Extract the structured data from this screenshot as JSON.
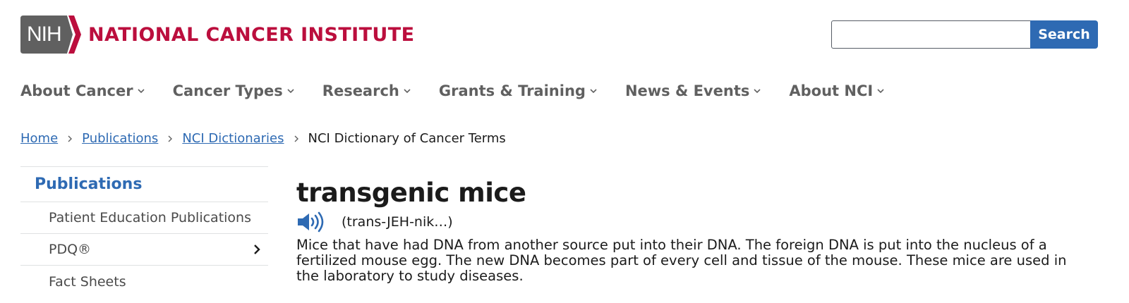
{
  "header": {
    "logo_mark": "NIH",
    "org_name": "NATIONAL CANCER INSTITUTE",
    "search_placeholder": "",
    "search_button": "Search",
    "brand_color": "#bb0e3d",
    "logo_gray": "#606060"
  },
  "nav": {
    "items": [
      {
        "label": "About Cancer",
        "icon": "chevron-down-icon"
      },
      {
        "label": "Cancer Types",
        "icon": "chevron-down-icon"
      },
      {
        "label": "Research",
        "icon": "chevron-down-icon"
      },
      {
        "label": "Grants & Training",
        "icon": "chevron-down-icon"
      },
      {
        "label": "News & Events",
        "icon": "chevron-down-icon"
      },
      {
        "label": "About NCI",
        "icon": "chevron-down-icon"
      }
    ]
  },
  "breadcrumb": {
    "items": [
      "Home",
      "Publications",
      "NCI Dictionaries"
    ],
    "current": "NCI Dictionary of Cancer Terms"
  },
  "sidebar": {
    "title": "Publications",
    "items": [
      {
        "label": "Patient Education Publications"
      },
      {
        "label": "PDQ®",
        "icon": "chevron-right-icon"
      },
      {
        "label": "Fact Sheets"
      }
    ]
  },
  "entry": {
    "term": "transgenic mice",
    "pronunciation": "(trans-JEH-nik…)",
    "audio_icon": "speaker-icon",
    "definition": "Mice that have had DNA from another source put into their DNA. The foreign DNA is put into the nucleus of a fertilized mouse egg. The new DNA becomes part of every cell and tissue of the mouse. These mice are used in the laboratory to study diseases."
  },
  "colors": {
    "link": "#2e6ab3",
    "search_button": "#2e6ab3",
    "nav_text": "#606060"
  }
}
